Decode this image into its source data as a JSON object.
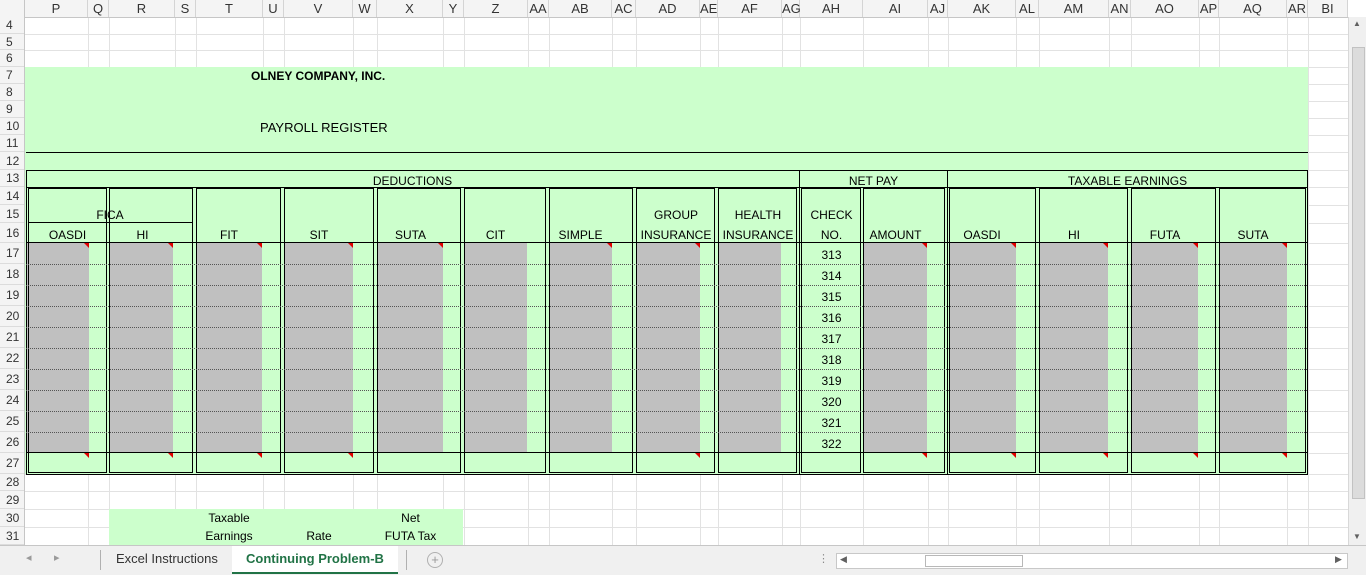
{
  "columns": [
    "P",
    "Q",
    "R",
    "S",
    "T",
    "U",
    "V",
    "W",
    "X",
    "Y",
    "Z",
    "AA",
    "AB",
    "AC",
    "AD",
    "AE",
    "AF",
    "AG",
    "AH",
    "AI",
    "AJ",
    "AK",
    "AL",
    "AM",
    "AN",
    "AO",
    "AP",
    "AQ",
    "AR",
    "BI"
  ],
  "rows": [
    "4",
    "5",
    "6",
    "7",
    "8",
    "9",
    "10",
    "11",
    "12",
    "13",
    "14",
    "15",
    "16",
    "17",
    "18",
    "19",
    "20",
    "21",
    "22",
    "23",
    "24",
    "25",
    "26",
    "27",
    "28",
    "29",
    "30",
    "31"
  ],
  "sheet": {
    "company": "OLNEY COMPANY, INC.",
    "report": "PAYROLL REGISTER",
    "groups": {
      "deductions": "DEDUCTIONS",
      "net_pay": "NET PAY",
      "taxable": "TAXABLE EARNINGS",
      "fica": "FICA"
    },
    "headers": {
      "oasdi": "OASDI",
      "hi": "HI",
      "fit": "FIT",
      "sit": "SIT",
      "suta": "SUTA",
      "cit": "CIT",
      "simple": "SIMPLE",
      "group1": "GROUP",
      "group2": "INSURANCE",
      "health1": "HEALTH",
      "health2": "INSURANCE",
      "check1": "CHECK",
      "check2": "NO.",
      "amount": "AMOUNT",
      "t_oasdi": "OASDI",
      "t_hi": "HI",
      "t_futa": "FUTA",
      "t_suta": "SUTA"
    },
    "check_numbers": [
      "313",
      "314",
      "315",
      "316",
      "317",
      "318",
      "319",
      "320",
      "321",
      "322"
    ],
    "futa_table": {
      "taxable1": "Taxable",
      "taxable2": "Earnings",
      "rate": "Rate",
      "net1": "Net",
      "net2": "FUTA Tax"
    }
  },
  "tabs": {
    "instructions": "Excel Instructions",
    "problem": "Continuing Problem-B"
  },
  "colors": {
    "sheet_bg": "#ccffcc",
    "input_cell": "#c0c0c0",
    "active_tab": "#217346",
    "comment_flag": "#e00000"
  }
}
